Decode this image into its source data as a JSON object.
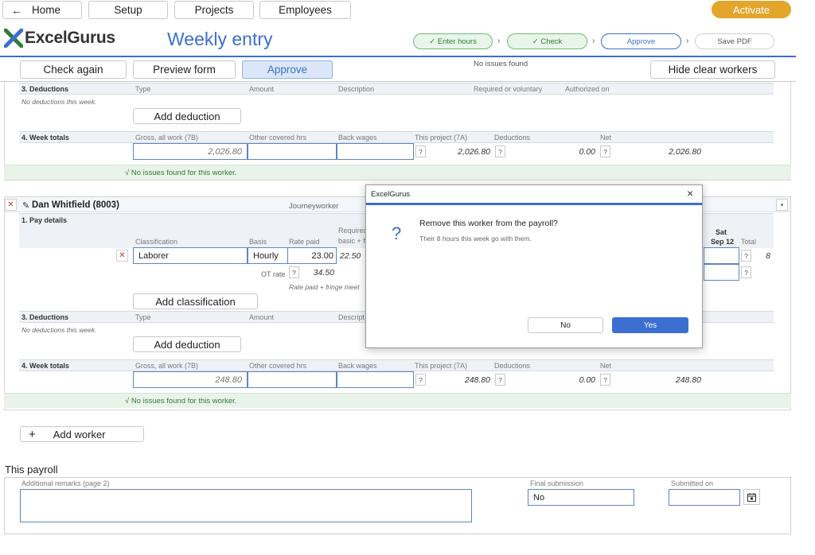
{
  "nav": {
    "home": "Home",
    "setup": "Setup",
    "projects": "Projects",
    "employees": "Employees",
    "activate": "Activate"
  },
  "brand": {
    "logo_text": "ExcelGurus"
  },
  "page": {
    "title": "Weekly entry"
  },
  "steps": [
    {
      "label": "✓ Enter hours"
    },
    {
      "label": "✓ Check"
    },
    {
      "label": "Approve"
    },
    {
      "label": "Save PDF"
    }
  ],
  "toolbar": {
    "check_again": "Check again",
    "preview_form": "Preview form",
    "approve": "Approve",
    "no_issues": "No issues found",
    "hide_clear": "Hide clear workers"
  },
  "worker1": {
    "deductions": {
      "title": "3. Deductions",
      "cols": [
        "Type",
        "Amount",
        "Description",
        "Required or voluntary",
        "Authorized on"
      ],
      "empty": "No deductions this week.",
      "add": "Add deduction"
    },
    "totals": {
      "title": "4. Week totals",
      "cols": [
        "Gross, all work (7B)",
        "Other covered hrs",
        "Back wages",
        "This project (7A)",
        "Deductions",
        "Net"
      ],
      "gross": "2,026.80",
      "this_project": "2,026.80",
      "deductions": "0.00",
      "net": "2,026.80"
    },
    "status": "√  No issues found for this worker."
  },
  "worker2": {
    "name": "Dan Whitfield (8003)",
    "type": "Journeyworker",
    "pay": {
      "title": "1. Pay details",
      "cols": {
        "classification": "Classification",
        "basis": "Basis",
        "rate": "Rate paid",
        "required_1": "Required",
        "required_2": "basic + f",
        "day": "Sat",
        "date": "Sep 12",
        "total": "Total"
      },
      "classification": "Laborer",
      "basis": "Hourly",
      "rate": "23.00",
      "required": "22.50",
      "total": "8",
      "ot_label": "OT rate",
      "ot_value": "34.50",
      "rate_note": "Rate paid + fringe meet",
      "add": "Add classification"
    },
    "deductions": {
      "title": "3. Deductions",
      "cols": [
        "Type",
        "Amount",
        "Descript"
      ],
      "empty": "No deductions this week.",
      "add": "Add deduction"
    },
    "totals": {
      "title": "4. Week totals",
      "cols": [
        "Gross, all work (7B)",
        "Other covered hrs",
        "Back wages",
        "This project (7A)",
        "Deductions",
        "Net"
      ],
      "gross": "248.80",
      "this_project": "248.80",
      "deductions": "0.00",
      "net": "248.80"
    },
    "status": "√  No issues found for this worker."
  },
  "add_worker": "Add worker",
  "payroll": {
    "heading": "This payroll",
    "remarks_label": "Additional remarks (page 2)",
    "final_label": "Final submission",
    "final_value": "No",
    "submitted_label": "Submitted on"
  },
  "dialog": {
    "title": "ExcelGurus",
    "question_mark": "?",
    "message": "Remove this worker from the payroll?",
    "detail": "Their 8 hours this week go with them.",
    "no": "No",
    "yes": "Yes"
  },
  "colors": {
    "accent_blue": "#3b6fd0",
    "brand_green": "#2e7d32",
    "activate": "#e3a52a",
    "approve_fill": "#dbe7f8"
  }
}
